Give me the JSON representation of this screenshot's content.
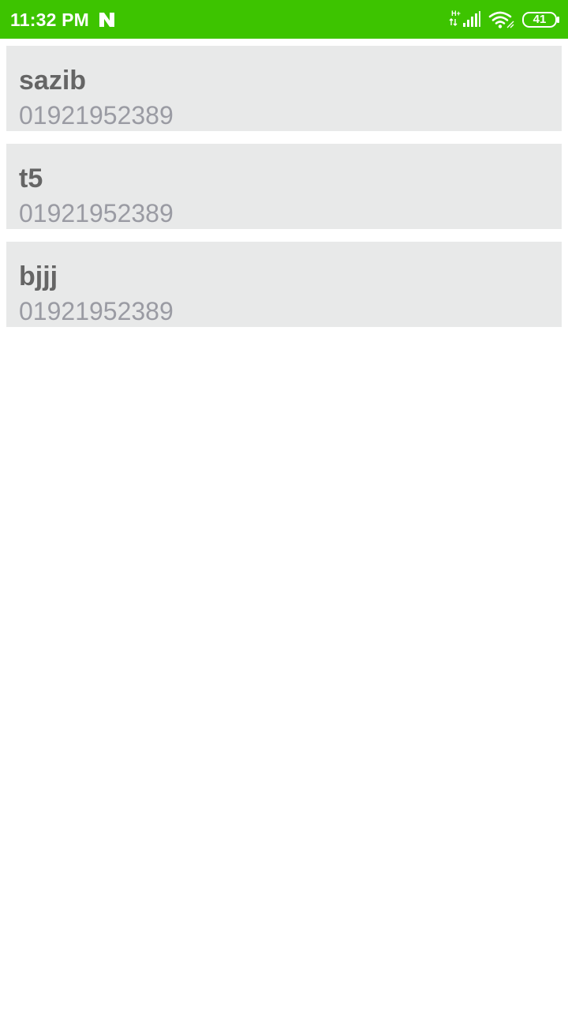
{
  "status_bar": {
    "time": "11:32 PM",
    "notification_icon": "n-logo-icon",
    "network_type": "H+",
    "signal_icon": "signal-icon",
    "wifi_icon": "wifi-icon",
    "battery_level": "41",
    "background_color": "#3dc400"
  },
  "contacts": [
    {
      "name": "sazib",
      "phone": "01921952389"
    },
    {
      "name": "t5",
      "phone": "01921952389"
    },
    {
      "name": "bjjj",
      "phone": "01921952389"
    }
  ],
  "colors": {
    "card_background": "#e8e9e9",
    "name_text": "#656565",
    "phone_text": "#9a9ba3"
  }
}
